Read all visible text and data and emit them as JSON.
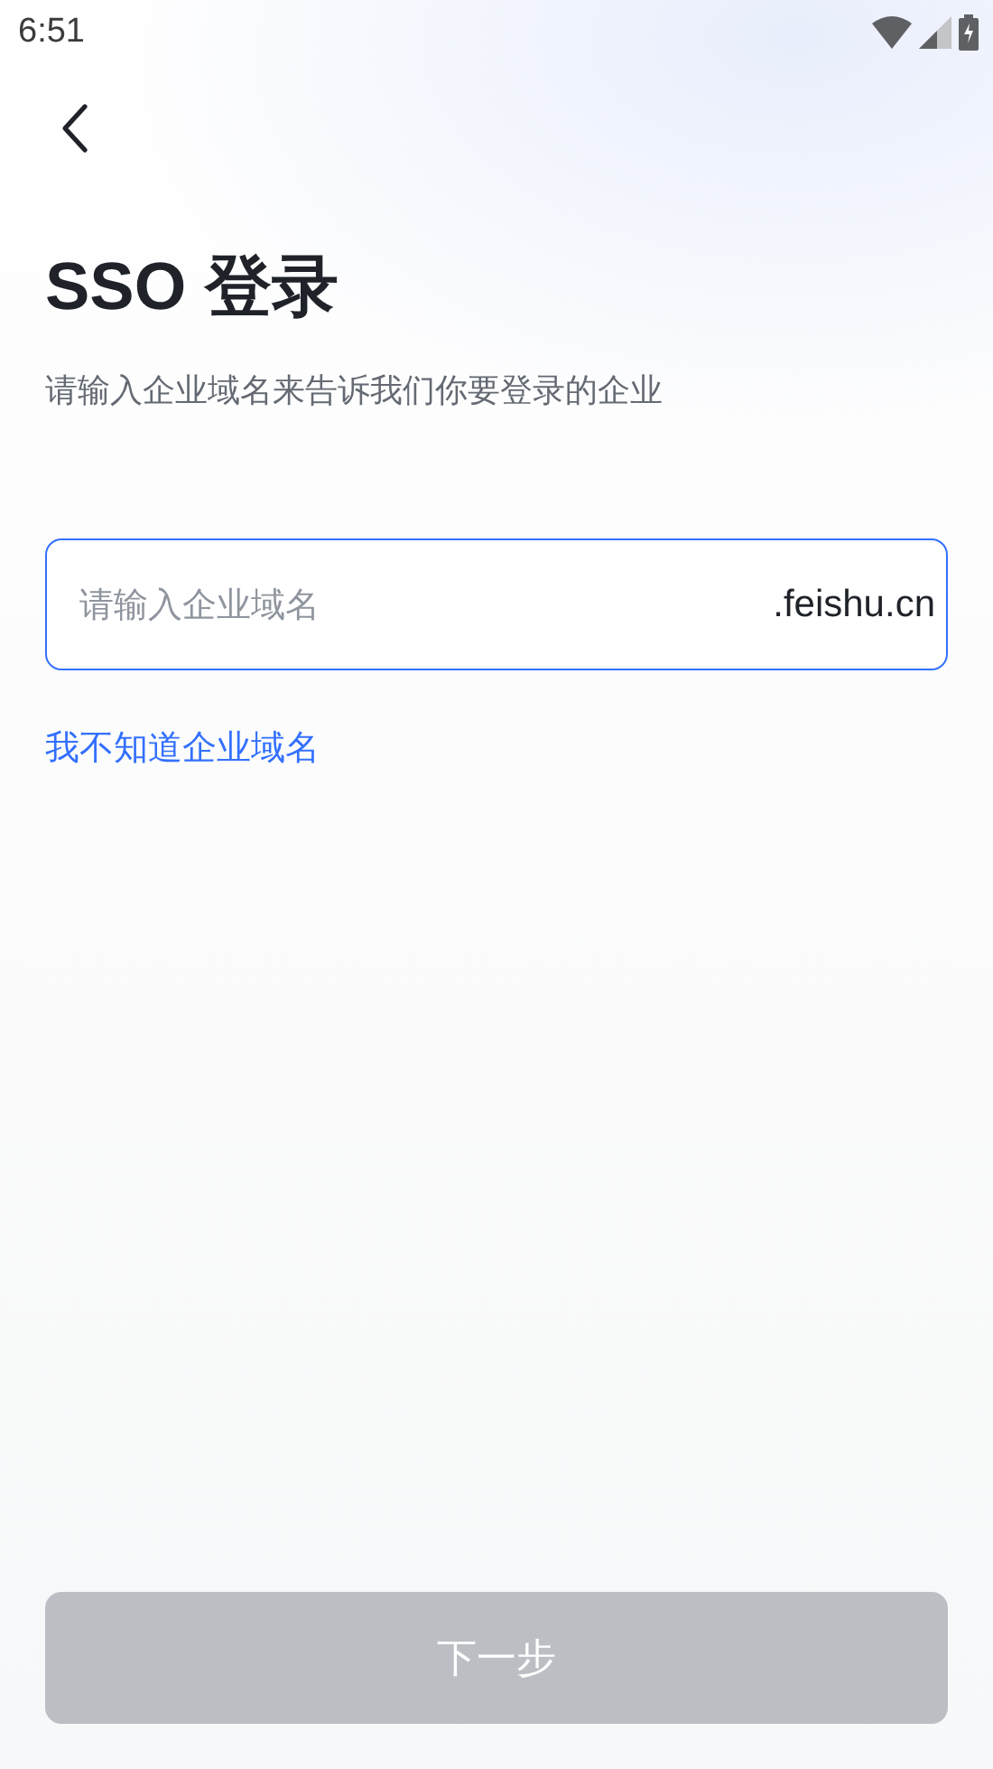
{
  "status_bar": {
    "time": "6:51"
  },
  "title": "SSO 登录",
  "subtitle": "请输入企业域名来告诉我们你要登录的企业",
  "domain_field": {
    "placeholder": "请输入企业域名",
    "suffix": ".feishu.cn",
    "focused": true
  },
  "help_link": "我不知道企业域名",
  "next_button": {
    "label": "下一步",
    "disabled": true
  }
}
